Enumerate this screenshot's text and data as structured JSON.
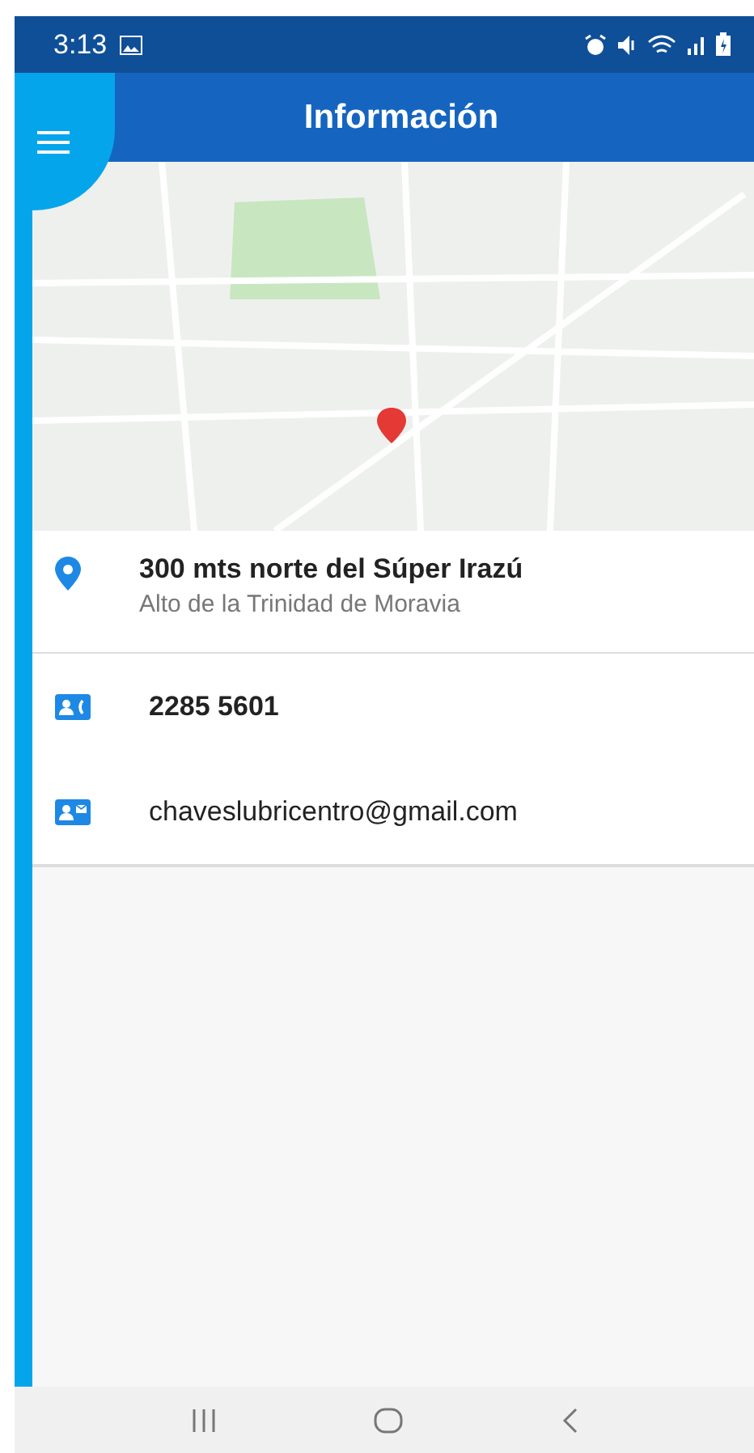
{
  "status_bar": {
    "time": "3:13"
  },
  "app_bar": {
    "title": "Información"
  },
  "address": {
    "line_1": "300 mts norte del Súper Irazú",
    "line_2": "Alto de la Trinidad de Moravia"
  },
  "contacts": [
    {
      "kind": "phone",
      "text": "2285 5601"
    },
    {
      "kind": "email",
      "text": "chaveslubricentro@gmail.com"
    }
  ]
}
